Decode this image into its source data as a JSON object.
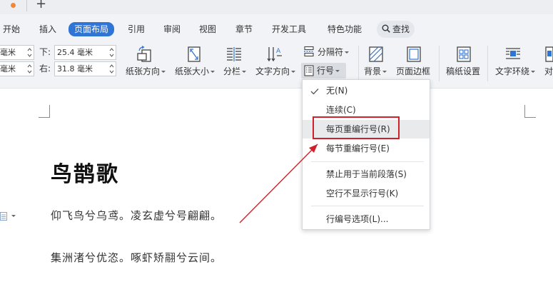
{
  "tabbar": {
    "new_tab": "+"
  },
  "menu": {
    "items": [
      "开始",
      "插入",
      "页面布局",
      "引用",
      "审阅",
      "视图",
      "章节",
      "开发工具",
      "特色功能"
    ],
    "active": "页面布局",
    "search_label": "查找"
  },
  "margins": {
    "top_left_value": "毫米",
    "bottom_left_value": "毫米",
    "bottom_label": "下:",
    "bottom_value": "25.4 毫米",
    "right_label": "右:",
    "right_value": "31.8 毫米"
  },
  "ribbon": {
    "orientation": "纸张方向",
    "size": "纸张大小",
    "columns": "分栏",
    "text_direction": "文字方向",
    "separator": "分隔符",
    "line_number": "行号",
    "background": "背景",
    "page_border": "页面边框",
    "manuscript": "稿纸设置",
    "text_wrap": "文字环绕",
    "align": "对"
  },
  "dropdown": {
    "items": [
      "无(N)",
      "连续(C)",
      "每页重编行号(R)",
      "每节重编行号(E)",
      "禁止用于当前段落(S)",
      "空行不显示行号(K)",
      "行编号选项(L)..."
    ],
    "checked_index": 0,
    "hover_index": 2
  },
  "document": {
    "title": "鸟鹊歌",
    "lines": [
      "仰飞鸟兮乌鸢。凌玄虚兮号翩翩。",
      "集洲渚兮优恣。啄虾矫翮兮云间。"
    ]
  },
  "colors": {
    "accent": "#2f75d6",
    "highlight": "#d0202c"
  }
}
